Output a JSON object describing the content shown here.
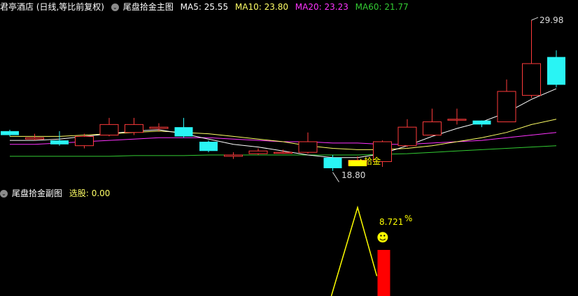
{
  "main_header": {
    "title": "君亭酒店 (日线,等比前复权)",
    "indicator": "尾盘拾金主图",
    "ma5": "MA5: 25.55",
    "ma10": "MA10: 23.80",
    "ma20": "MA20: 23.23",
    "ma60": "MA60: 21.77"
  },
  "sub_header": {
    "indicator": "尾盘拾金副图",
    "select": "选股: 0.00"
  },
  "annotations": {
    "high": "29.98",
    "low": "18.80",
    "signal": "▲拾金",
    "percent_value": "8.721",
    "percent_sign": "%",
    "smiley": "☻"
  },
  "colors": {
    "up": "#ff3b3b",
    "down": "#29f4f4",
    "ma5": "#ffffff",
    "ma10": "#ffff66",
    "ma20": "#ff33ff",
    "ma60": "#33cc33",
    "signal": "#ffff00",
    "bar": "#ff0000"
  },
  "chart_data": {
    "type": "candlestick",
    "candles": [
      {
        "o": 21.6,
        "c": 21.3,
        "h": 21.7,
        "l": 21.2
      },
      {
        "o": 21.0,
        "c": 21.1,
        "h": 21.4,
        "l": 20.9
      },
      {
        "o": 20.9,
        "c": 20.6,
        "h": 21.6,
        "l": 20.5
      },
      {
        "o": 20.5,
        "c": 21.2,
        "h": 21.4,
        "l": 20.3
      },
      {
        "o": 21.3,
        "c": 22.1,
        "h": 22.6,
        "l": 21.2
      },
      {
        "o": 21.5,
        "c": 22.1,
        "h": 22.6,
        "l": 21.3
      },
      {
        "o": 21.8,
        "c": 21.9,
        "h": 22.2,
        "l": 21.6
      },
      {
        "o": 21.9,
        "c": 21.2,
        "h": 22.6,
        "l": 21.1
      },
      {
        "o": 20.8,
        "c": 20.1,
        "h": 20.9,
        "l": 20.0
      },
      {
        "o": 19.7,
        "c": 19.8,
        "h": 20.0,
        "l": 19.5
      },
      {
        "o": 19.9,
        "c": 20.1,
        "h": 20.3,
        "l": 19.8
      },
      {
        "o": 20.0,
        "c": 20.0,
        "h": 20.2,
        "l": 19.9
      },
      {
        "o": 20.0,
        "c": 20.8,
        "h": 21.5,
        "l": 19.9
      },
      {
        "o": 19.6,
        "c": 18.8,
        "h": 19.8,
        "l": 18.6
      },
      {
        "o": 19.0,
        "c": 19.4,
        "h": 19.7,
        "l": 19.0
      },
      {
        "o": 19.3,
        "c": 20.8,
        "h": 20.9,
        "l": 18.9
      },
      {
        "o": 20.5,
        "c": 21.9,
        "h": 22.5,
        "l": 20.4
      },
      {
        "o": 21.3,
        "c": 22.3,
        "h": 23.3,
        "l": 21.3
      },
      {
        "o": 22.5,
        "c": 22.5,
        "h": 23.3,
        "l": 22.1
      },
      {
        "o": 22.4,
        "c": 22.1,
        "h": 22.4,
        "l": 21.9
      },
      {
        "o": 22.3,
        "c": 24.6,
        "h": 25.5,
        "l": 22.3
      },
      {
        "o": 24.3,
        "c": 26.7,
        "h": 29.98,
        "l": 24.1
      },
      {
        "o": 27.2,
        "c": 25.1,
        "h": 27.7,
        "l": 24.9
      }
    ],
    "ma5": [
      20.9,
      20.9,
      21.0,
      21.2,
      21.4,
      21.6,
      21.7,
      21.4,
      21.0,
      20.6,
      20.4,
      20.1,
      19.8,
      19.6,
      19.6,
      19.9,
      20.5,
      21.2,
      21.8,
      22.3,
      23.0,
      24.0,
      24.8
    ],
    "ma10": [
      21.2,
      21.2,
      21.2,
      21.3,
      21.4,
      21.5,
      21.6,
      21.5,
      21.4,
      21.2,
      21.0,
      20.8,
      20.5,
      20.3,
      20.2,
      20.2,
      20.3,
      20.5,
      20.8,
      21.1,
      21.5,
      22.1,
      22.5
    ],
    "ma20": [
      20.6,
      20.6,
      20.7,
      20.8,
      20.9,
      21.0,
      21.1,
      21.1,
      21.1,
      21.0,
      20.9,
      20.8,
      20.8,
      20.7,
      20.7,
      20.6,
      20.6,
      20.7,
      20.8,
      20.9,
      21.1,
      21.3,
      21.5
    ],
    "ma60": [
      19.7,
      19.7,
      19.7,
      19.7,
      19.7,
      19.75,
      19.75,
      19.75,
      19.8,
      19.8,
      19.8,
      19.8,
      19.8,
      19.8,
      19.8,
      19.85,
      19.9,
      20.0,
      20.1,
      20.2,
      20.3,
      20.4,
      20.5
    ],
    "signal_index": 14,
    "sub_line": [
      0,
      0,
      0,
      0,
      0,
      0,
      0,
      0,
      0,
      0,
      0,
      0,
      0,
      0.5,
      7.1,
      0,
      0,
      0,
      0,
      0,
      0,
      0,
      0
    ],
    "sub_bar_index": 15,
    "sub_bar_value": 8.721
  }
}
